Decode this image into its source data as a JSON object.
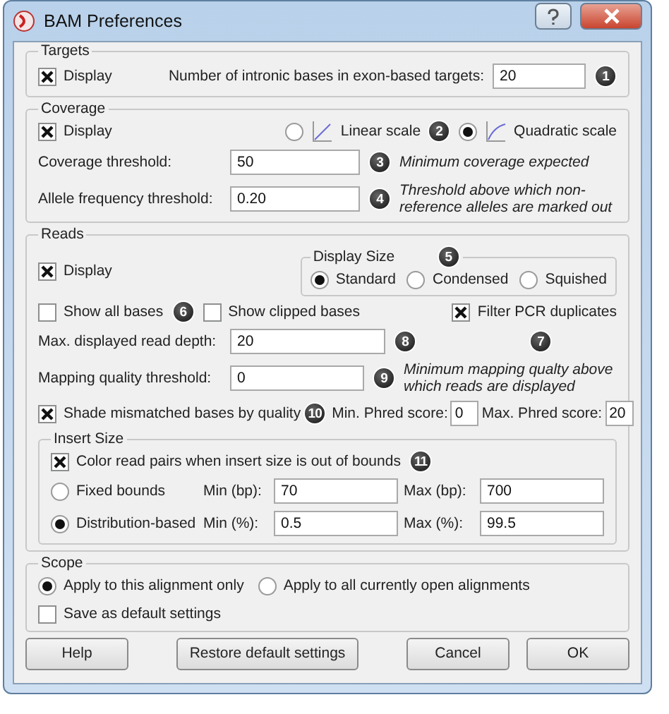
{
  "window": {
    "title": "BAM Preferences"
  },
  "targets": {
    "title": "Targets",
    "display": {
      "label": "Display",
      "checked": true
    },
    "bases_label": "Number of intronic bases in exon-based targets:",
    "bases_value": "20"
  },
  "coverage": {
    "title": "Coverage",
    "display": {
      "label": "Display",
      "checked": true
    },
    "scales": [
      {
        "label": "Linear scale",
        "selected": false,
        "kind": "linear"
      },
      {
        "label": "Quadratic scale",
        "selected": true,
        "kind": "quadratic"
      }
    ],
    "fields": [
      {
        "label": "Coverage threshold:",
        "value": "50",
        "hint": "Minimum coverage expected"
      },
      {
        "label": "Allele frequency threshold:",
        "value": "0.20",
        "hint": "Threshold above which non-reference alleles are marked out"
      }
    ]
  },
  "reads": {
    "title": "Reads",
    "display": {
      "label": "Display",
      "checked": true
    },
    "display_size": {
      "title": "Display Size",
      "options": [
        {
          "label": "Standard",
          "selected": true
        },
        {
          "label": "Condensed",
          "selected": false
        },
        {
          "label": "Squished",
          "selected": false
        }
      ]
    },
    "show_all_bases": {
      "label": "Show all bases",
      "checked": false
    },
    "show_clipped_bases": {
      "label": "Show clipped bases",
      "checked": false
    },
    "filter_pcr": {
      "label": "Filter PCR duplicates",
      "checked": true
    },
    "depth": {
      "label": "Max. displayed  read depth:",
      "value": "20"
    },
    "mapping": {
      "label": "Mapping quality threshold:",
      "value": "0",
      "hint": "Minimum mapping qualty above which reads are displayed"
    },
    "shade": {
      "label": "Shade mismatched bases by quality",
      "checked": true
    },
    "min_phred": {
      "label": "Min. Phred score:",
      "value": "0"
    },
    "max_phred": {
      "label": "Max. Phred score:",
      "value": "20"
    },
    "insert_size": {
      "title": "Insert Size",
      "color_pairs": {
        "label": "Color read pairs when insert size is out of bounds",
        "checked": true
      },
      "modes": [
        {
          "label": "Fixed bounds",
          "selected": false,
          "min_label": "Min (bp):",
          "min_value": "70",
          "max_label": "Max (bp):",
          "max_value": "700"
        },
        {
          "label": "Distribution-based",
          "selected": true,
          "min_label": "Min (%):",
          "min_value": "0.5",
          "max_label": "Max (%):",
          "max_value": "99.5"
        }
      ]
    }
  },
  "scope": {
    "title": "Scope",
    "options": [
      {
        "label": "Apply to this alignment only",
        "selected": true
      },
      {
        "label": "Apply to all currently open alignments",
        "selected": false
      }
    ],
    "save_default": {
      "label": "Save as default settings",
      "checked": false
    }
  },
  "buttons": [
    "Help",
    "Restore default settings",
    "Cancel",
    "OK"
  ],
  "callouts": [
    "1",
    "2",
    "3",
    "4",
    "5",
    "6",
    "7",
    "8",
    "9",
    "10",
    "11"
  ]
}
